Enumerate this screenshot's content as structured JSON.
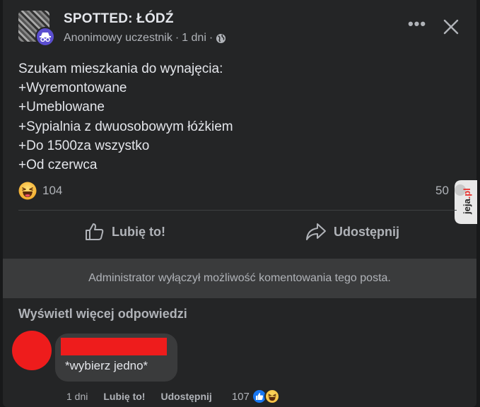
{
  "post": {
    "group_name": "SPOTTED: ŁÓDŹ",
    "author": "Anonimowy uczestnik",
    "separator": "·",
    "time": "1 dni",
    "more_label": "•••",
    "body_lines": [
      "Szukam mieszkania do wynajęcia:",
      "+Wyremontowane",
      "+Umeblowane",
      "+Sypialnia z dwuosobowym łóżkiem",
      "+Do 1500za wszystko",
      "+Od czerwca"
    ],
    "reaction_count": "104",
    "comment_count": "50",
    "watermark": "jeja.pl"
  },
  "actions": {
    "like": "Lubię to!",
    "share": "Udostępnij"
  },
  "comments_disabled": "Administrator wyłączył możliwość komentowania tego posta.",
  "more_replies": "Wyświetl więcej odpowiedzi",
  "comment": {
    "text": "*wybierz jedno*",
    "time": "1 dni",
    "like": "Lubię to!",
    "share": "Udostępnij",
    "reaction_count": "107"
  },
  "colors": {
    "background": "#18191a",
    "card": "#242526",
    "text": "#e4e6eb",
    "secondary_text": "#b0b3b8",
    "redaction": "#ee1c1c",
    "like_blue": "#1877f2",
    "anon_badge": "#5b4ed0"
  },
  "icons": [
    "group-avatar",
    "anonymous-icon",
    "globe-icon",
    "more-icon",
    "close-icon",
    "haha-icon",
    "like-outline-icon",
    "share-icon",
    "like-icon"
  ]
}
